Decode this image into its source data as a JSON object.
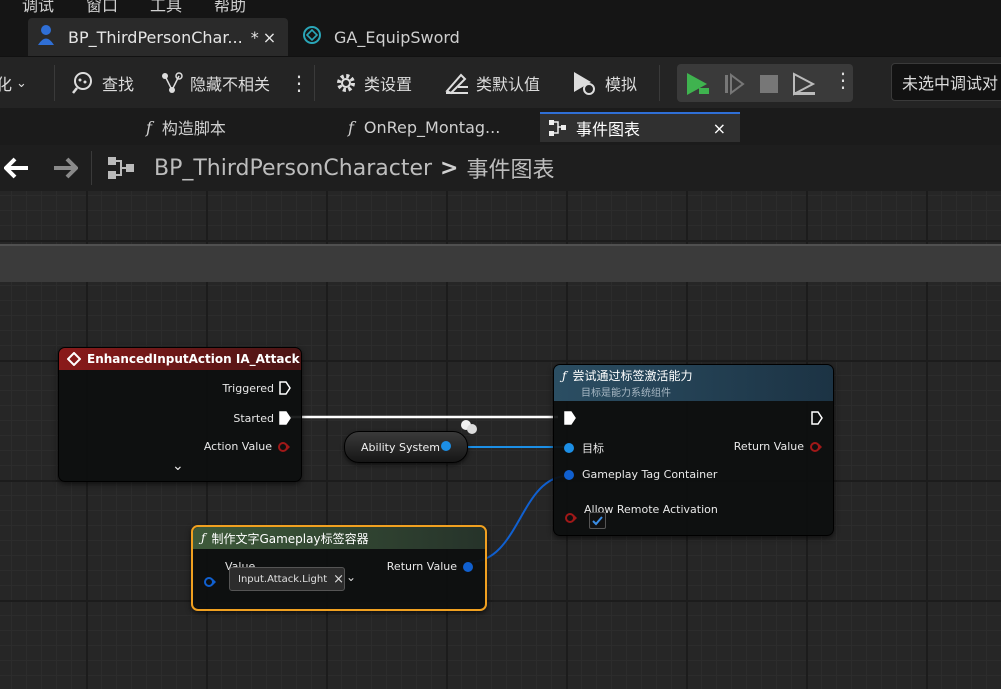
{
  "menu": [
    "调试",
    "窗口",
    "工具",
    "帮助"
  ],
  "doc_tabs": [
    {
      "label": "BP_ThirdPersonChar...",
      "modified": "*",
      "close": "×"
    },
    {
      "label": "GA_EquipSword"
    }
  ],
  "toolbar": {
    "compile_suffix": "化",
    "find": "查找",
    "hide_unrelated": "隐藏不相关",
    "class_settings": "类设置",
    "class_defaults": "类默认值",
    "simulate": "模拟",
    "debug_selector": "未选中调试对"
  },
  "graph_tabs": [
    {
      "label": "构造脚本",
      "fx": "f"
    },
    {
      "label": "OnRep_Montag...",
      "fx": "f"
    },
    {
      "label": "事件图表",
      "close": "×"
    }
  ],
  "breadcrumb": {
    "root": "BP_ThirdPersonCharacter",
    "sep": ">",
    "current": "事件图表"
  },
  "nodes": {
    "input_action": {
      "title": "EnhancedInputAction IA_Attack",
      "pins": [
        "Triggered",
        "Started",
        "Action Value"
      ],
      "expand": "⌄"
    },
    "ability_system": {
      "label": "Ability System"
    },
    "try_activate": {
      "title": "尝试通过标签激活能力",
      "subtitle": "目标是能力系统组件",
      "pins_in": [
        "目标",
        "Gameplay Tag Container",
        "Allow Remote Activation"
      ],
      "return": "Return Value",
      "allow_remote_checked": true
    },
    "make_tag": {
      "title": "制作文字Gameplay标签容器",
      "value_label": "Value",
      "return": "Return Value",
      "tag": "Input.Attack.Light",
      "tag_clear": "×"
    }
  },
  "colors": {
    "event_header": "#8a1a1a",
    "func_header": "#2b4e63",
    "pure_header": "#3e5a3a",
    "object_pin": "#1c8fe6",
    "struct_pin": "#1060d0",
    "bool_pin": "#8e1414",
    "selection": "#f0a020"
  }
}
